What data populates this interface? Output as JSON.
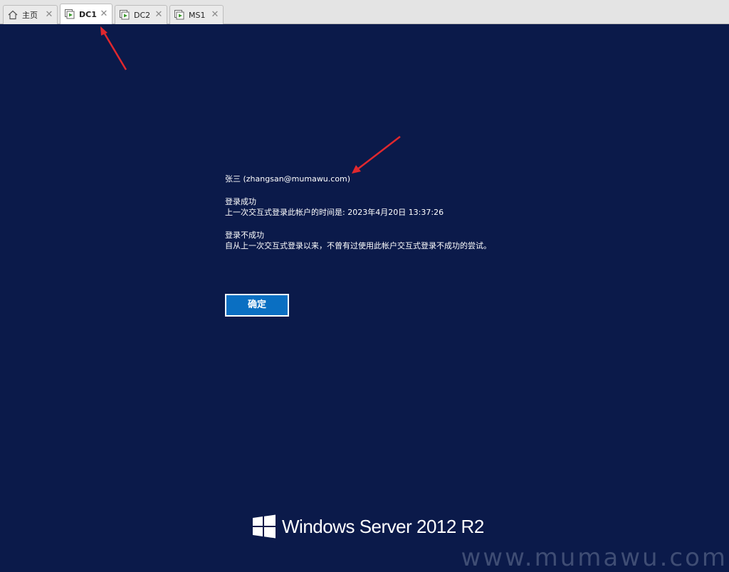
{
  "tabs": [
    {
      "label": "主页",
      "icon": "home-icon",
      "active": false
    },
    {
      "label": "DC1",
      "icon": "vm-running-icon",
      "active": true
    },
    {
      "label": "DC2",
      "icon": "vm-running-icon",
      "active": false
    },
    {
      "label": "MS1",
      "icon": "vm-running-icon",
      "active": false
    }
  ],
  "login": {
    "user": "张三 (zhangsan@mumawu.com)",
    "success_title": "登录成功",
    "success_detail": "上一次交互式登录此帐户的时间是: 2023年4月20日 13:37:26",
    "failure_title": "登录不成功",
    "failure_detail": "自从上一次交互式登录以来，不曾有过使用此帐户交互式登录不成功的尝试。",
    "ok_label": "确定"
  },
  "branding": {
    "product": "Windows Server 2012 R2"
  },
  "watermark": "www.mumawu.com",
  "colors": {
    "background": "#0b1a4a",
    "button": "#0a6fc2",
    "annotation_arrow": "#e0282e",
    "vm_icon_green": "#3a9a2a"
  }
}
